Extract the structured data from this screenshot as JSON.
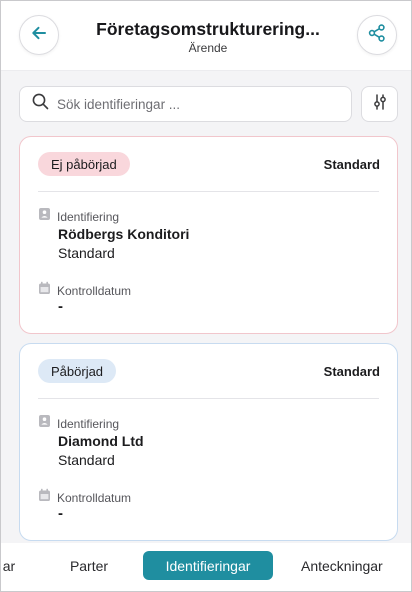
{
  "header": {
    "title": "Företagsomstrukturering...",
    "subtitle": "Ärende",
    "back_icon": "arrow-left-icon",
    "share_icon": "share-icon"
  },
  "search": {
    "placeholder": "Sök identifieringar ...",
    "value": "",
    "icon": "search-icon",
    "filter_icon": "sliders-icon"
  },
  "cards": [
    {
      "status": "Ej påbörjad",
      "type": "Standard",
      "ident_label": "Identifiering",
      "ident_name": "Rödbergs Konditori",
      "ident_type": "Standard",
      "date_label": "Kontrolldatum",
      "date_value": "-"
    },
    {
      "status": "Påbörjad",
      "type": "Standard",
      "ident_label": "Identifiering",
      "ident_name": "Diamond Ltd",
      "ident_type": "Standard",
      "date_label": "Kontrolldatum",
      "date_value": "-"
    }
  ],
  "tabs": [
    {
      "label": "ar"
    },
    {
      "label": "Parter"
    },
    {
      "label": "Identifieringar",
      "active": true
    },
    {
      "label": "Anteckningar"
    }
  ],
  "colors": {
    "accent": "#1f8ea0",
    "not_started_badge": "#f9d7dc",
    "not_started_border": "#f1c6cc",
    "started_badge": "#dde9f6",
    "started_border": "#c7dbf0"
  }
}
